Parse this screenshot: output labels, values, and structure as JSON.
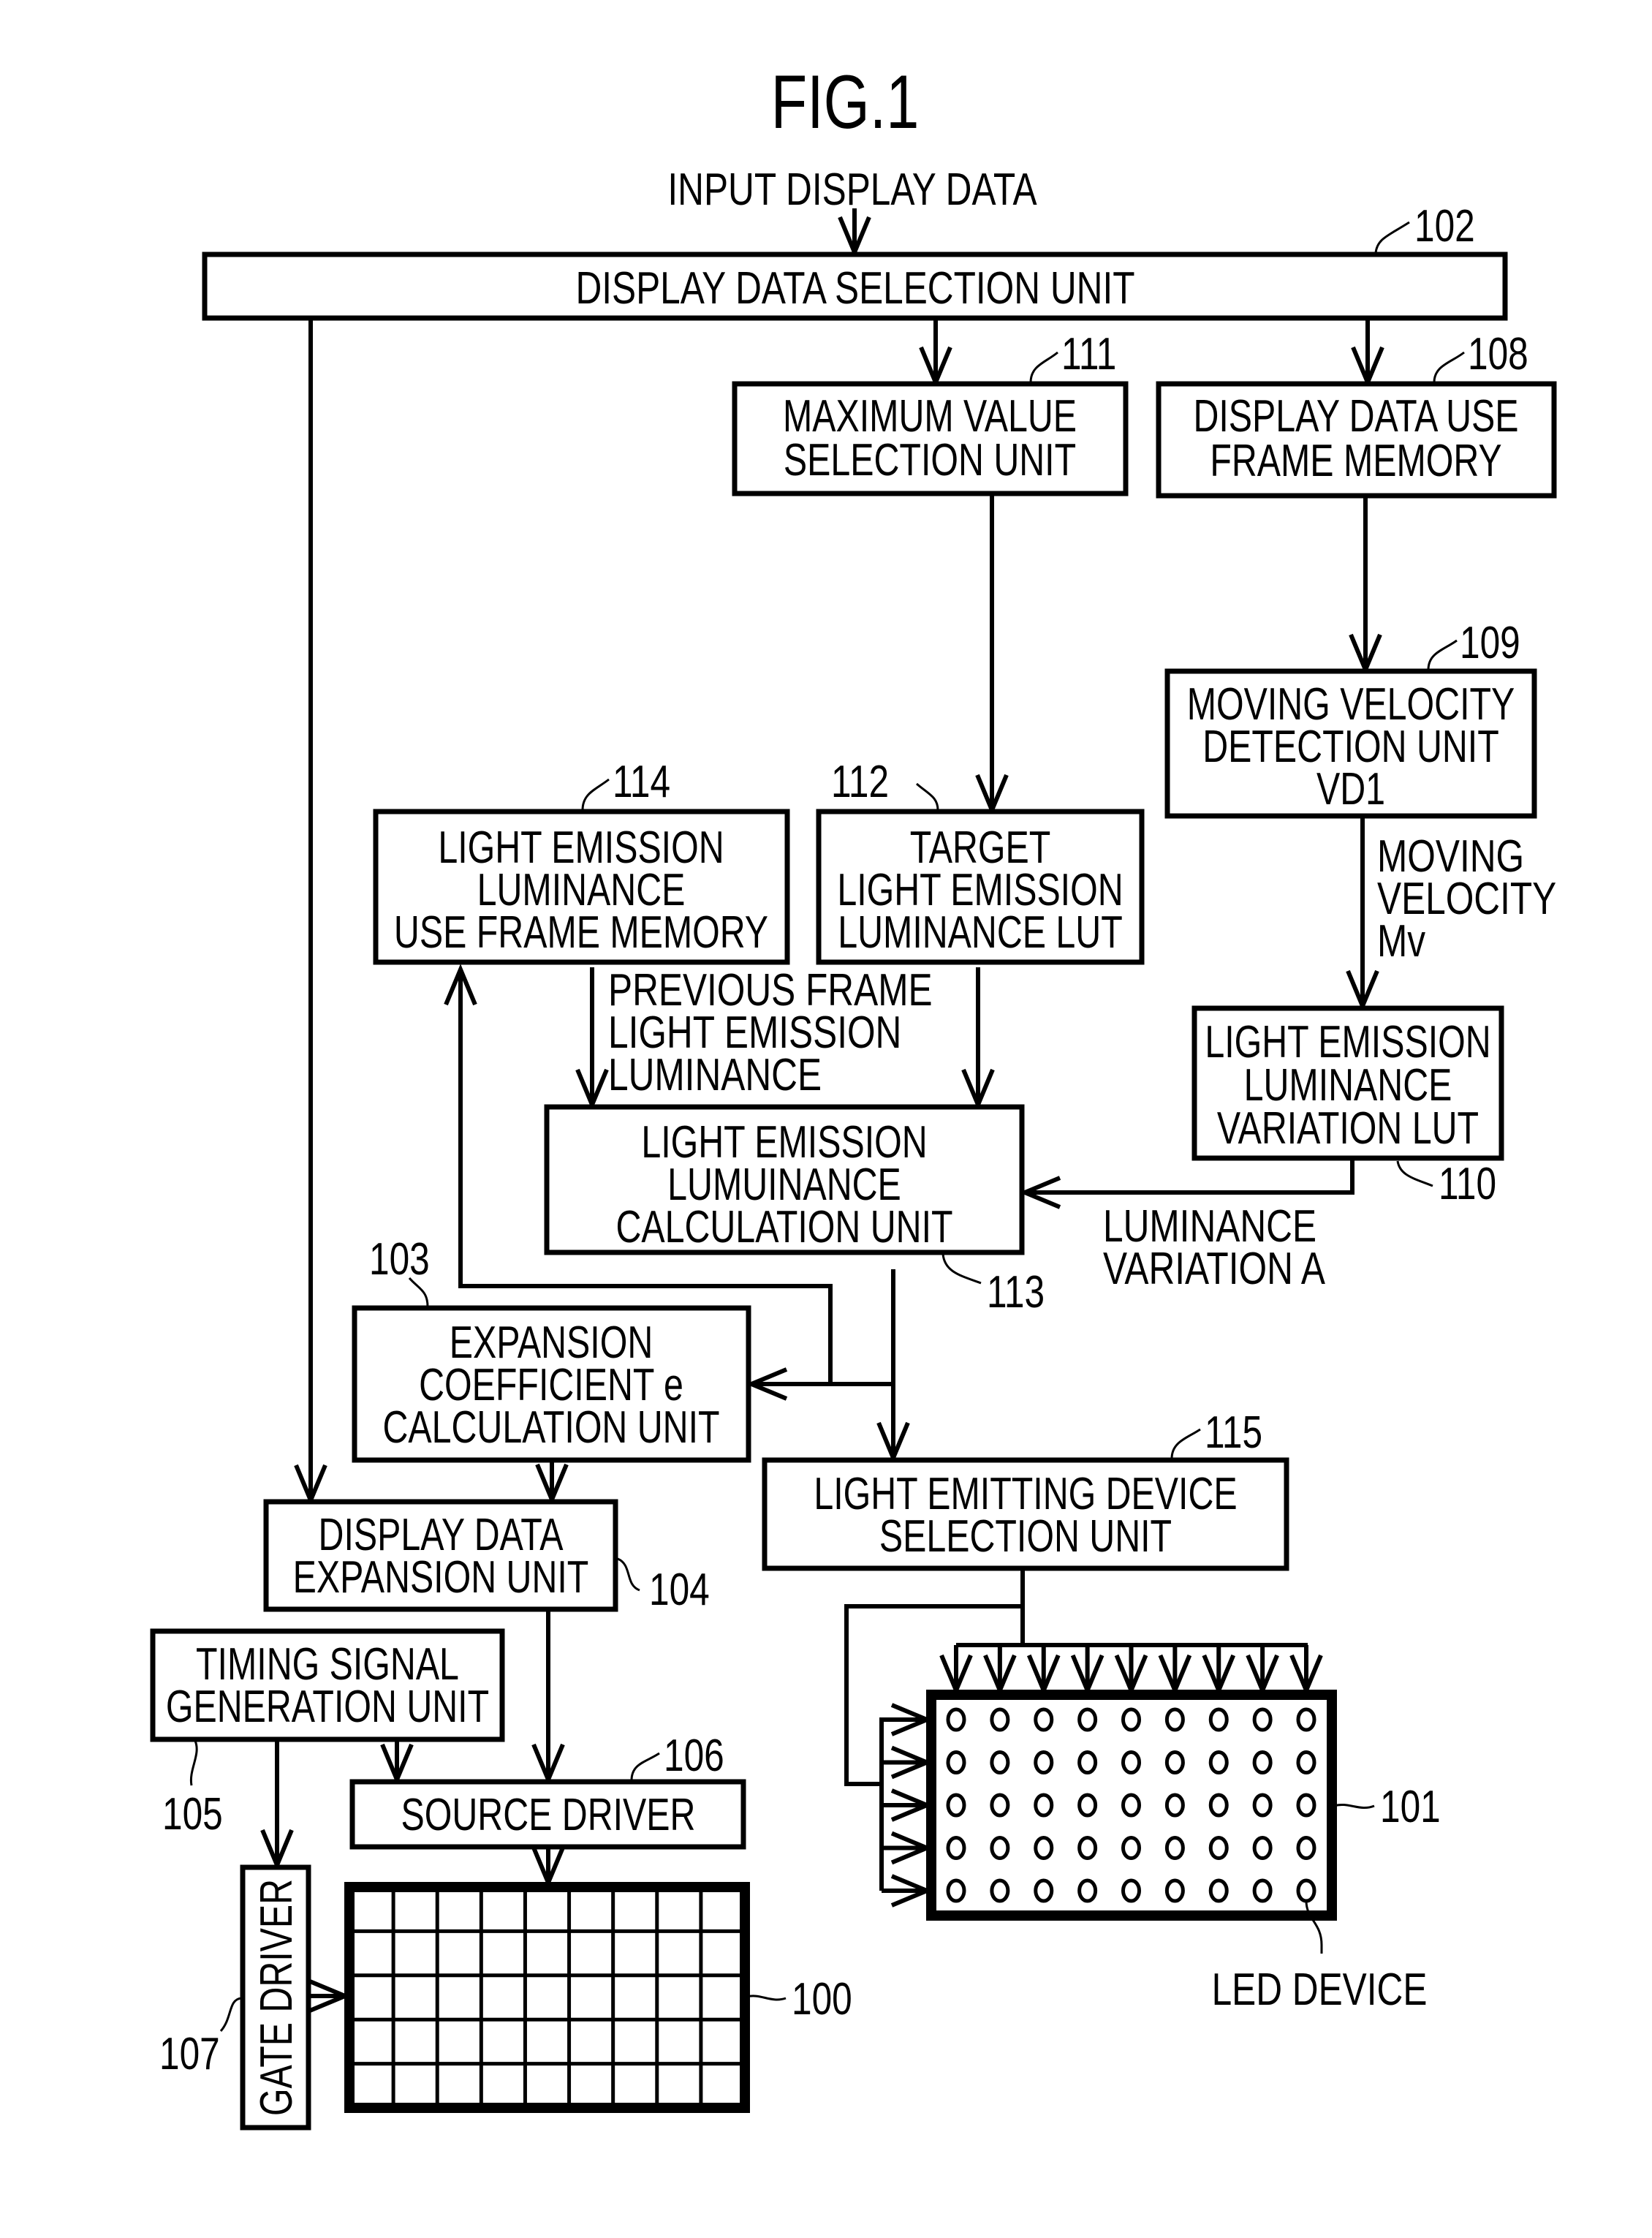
{
  "figure": {
    "title": "FIG.1",
    "input_label": "INPUT DISPLAY DATA"
  },
  "blocks": {
    "display_data_selection": {
      "ref": "102",
      "lines": [
        "DISPLAY DATA SELECTION UNIT"
      ]
    },
    "maximum_value_selection": {
      "ref": "111",
      "lines": [
        "MAXIMUM VALUE",
        "SELECTION UNIT"
      ]
    },
    "display_data_frame_memory": {
      "ref": "108",
      "lines": [
        "DISPLAY DATA USE",
        "FRAME MEMORY"
      ]
    },
    "moving_velocity_detection": {
      "ref": "109",
      "lines": [
        "MOVING VELOCITY",
        "DETECTION UNIT",
        "VD1"
      ]
    },
    "luminance_frame_memory": {
      "ref": "114",
      "lines": [
        "LIGHT EMISSION",
        "LUMINANCE",
        "USE FRAME MEMORY"
      ]
    },
    "target_luminance_lut": {
      "ref": "112",
      "lines": [
        "TARGET",
        "LIGHT EMISSION",
        "LUMINANCE LUT"
      ]
    },
    "luminance_variation_lut": {
      "ref": "110",
      "lines": [
        "LIGHT EMISSION",
        "LUMINANCE",
        "VARIATION LUT"
      ]
    },
    "luminance_calculation": {
      "ref": "113",
      "lines": [
        "LIGHT EMISSION",
        "LUMUINANCE",
        "CALCULATION UNIT"
      ]
    },
    "expansion_coefficient": {
      "ref": "103",
      "lines": [
        "EXPANSION",
        "COEFFICIENT e",
        "CALCULATION UNIT"
      ]
    },
    "light_emitting_device_selection": {
      "ref": "115",
      "lines": [
        "LIGHT EMITTING DEVICE",
        "SELECTION UNIT"
      ]
    },
    "display_data_expansion": {
      "ref": "104",
      "lines": [
        "DISPLAY DATA",
        "EXPANSION UNIT"
      ]
    },
    "timing_signal_generation": {
      "ref": "105",
      "lines": [
        "TIMING SIGNAL",
        "GENERATION UNIT"
      ]
    },
    "source_driver": {
      "ref": "106",
      "lines": [
        "SOURCE DRIVER"
      ]
    },
    "gate_driver": {
      "ref": "107",
      "lines": [
        "GATE DRIVER"
      ]
    },
    "display_panel": {
      "ref": "100",
      "rows": 5,
      "cols": 9
    },
    "led_backlight": {
      "ref": "101",
      "rows": 5,
      "cols": 9,
      "element_label": "LED DEVICE"
    }
  },
  "signals": {
    "moving_velocity": [
      "MOVING",
      "VELOCITY",
      "Mv"
    ],
    "previous_frame_luminance": [
      "PREVIOUS FRAME",
      "LIGHT EMISSION",
      "LUMINANCE"
    ],
    "luminance_variation": [
      "LUMINANCE",
      "VARIATION A"
    ]
  },
  "colors": {
    "ink": "#000000",
    "paper": "#ffffff"
  }
}
